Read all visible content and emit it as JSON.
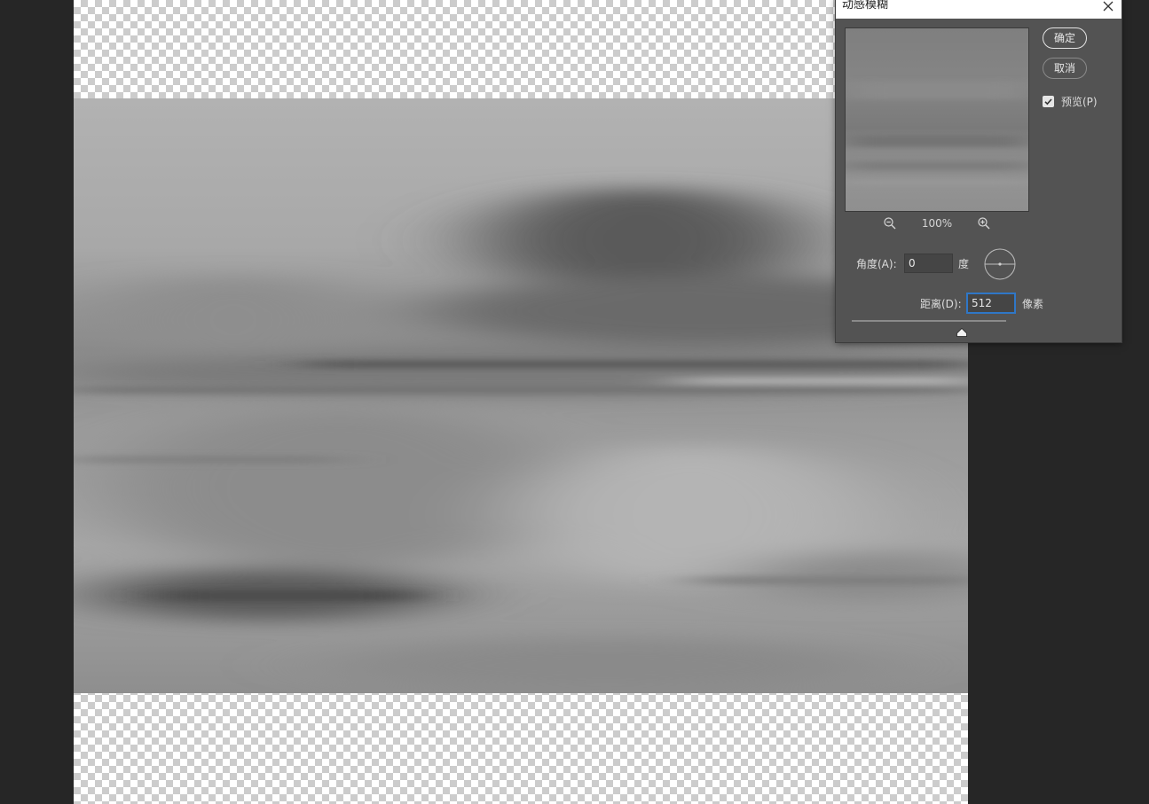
{
  "dialog": {
    "title": "动感模糊",
    "ok_label": "确定",
    "cancel_label": "取消",
    "preview_label": "预览(P)",
    "preview_checked": true,
    "zoom": "100%",
    "angle_label": "角度(A):",
    "angle_value": "0",
    "angle_unit": "度",
    "distance_label": "距离(D):",
    "distance_value": "512",
    "distance_unit": "像素",
    "distance_slider_fraction": 0.71
  },
  "icons": {
    "close": "close-icon",
    "zoom_out": "zoom-out-icon",
    "zoom_in": "zoom-in-icon",
    "check": "check-icon",
    "angle_dial": "angle-dial-icon"
  },
  "colors": {
    "workspace": "#262626",
    "dialog_bg": "#535353",
    "focus_border": "#2f77c7"
  }
}
